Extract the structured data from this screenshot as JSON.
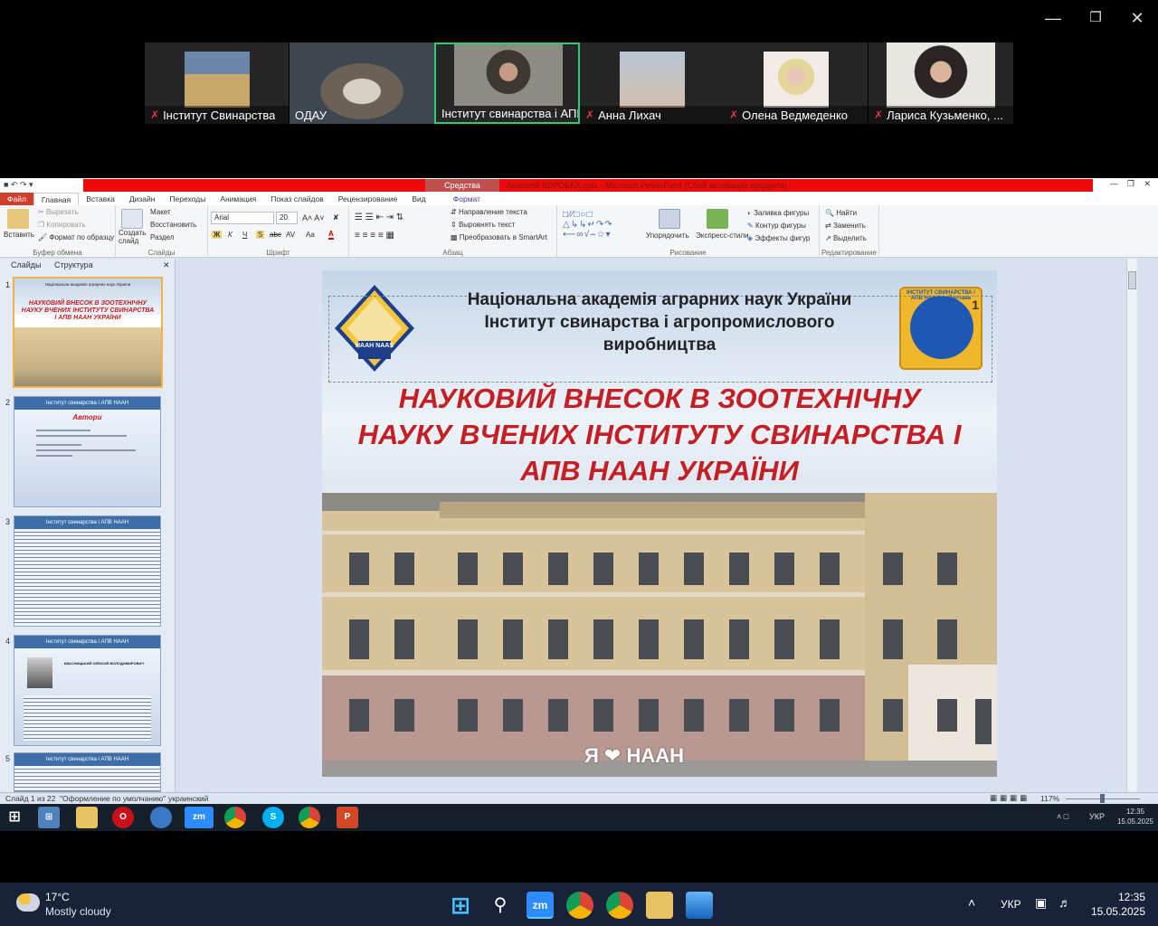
{
  "meeting": {
    "participants": [
      {
        "name": "Інститут Свинарства",
        "muted": true
      },
      {
        "name": "ОДАУ",
        "muted": false
      },
      {
        "name": "Інститут свинарства і АПВ",
        "muted": false,
        "active": true
      },
      {
        "name": "Анна Лихач",
        "muted": true
      },
      {
        "name": "Олена Ведмеденко",
        "muted": true
      },
      {
        "name": "Лариса Кузьменко, ...",
        "muted": true
      }
    ]
  },
  "ppt": {
    "context_tool": "Средства рисования",
    "document_title": "Анатолій КОРОБКА.pptx - Microsoft PowerPoint (Сбой активации продукта)",
    "tabs": [
      "Файл",
      "Главная",
      "Вставка",
      "Дизайн",
      "Переходы",
      "Анимация",
      "Показ слайдов",
      "Рецензирование",
      "Вид",
      "Формат"
    ],
    "ribbon": {
      "paste": "Вставить",
      "cut": "Вырезать",
      "copy": "Копировать",
      "format_painter": "Формат по образцу",
      "clipboard_group": "Буфер обмена",
      "new_slide": "Создать слайд",
      "layout": "Макет",
      "reset": "Восстановить",
      "section": "Раздел",
      "slides_group": "Слайды",
      "font_name": "Arial",
      "font_size": "20",
      "font_group": "Шрифт",
      "bold": "Ж",
      "italic": "К",
      "underline": "Ч",
      "shadow": "S",
      "strike": "abc",
      "spacing": "AV",
      "case": "Aa",
      "color_a": "A",
      "text_direction": "Направление текста",
      "align_text": "Выровнять текст",
      "smartart": "Преобразовать в SmartArt",
      "paragraph_group": "Абзац",
      "arrange": "Упорядочить",
      "quick_styles": "Экспресс-стили",
      "drawing_group": "Рисование",
      "shape_fill": "Заливка фигуры",
      "shape_outline": "Контур фигуры",
      "shape_effects": "Эффекты фигур",
      "find": "Найти",
      "replace": "Заменить",
      "select": "Выделить",
      "editing_group": "Редактирование"
    },
    "panel_tabs": [
      "Слайды",
      "Структура"
    ],
    "thumbnails": [
      {
        "num": "1",
        "head": "Національна академія аграрних наук України",
        "title": "НАУКОВИЙ ВНЕСОК В ЗООТЕХНІЧНУ НАУКУ ВЧЕНИХ ІНСТИТУТУ СВИНАРСТВА І АПВ НААН УКРАЇНИ"
      },
      {
        "num": "2",
        "head": "Інститут свинарства і АПВ НААН",
        "title": "Автори"
      },
      {
        "num": "3",
        "head": "Інститут свинарства і АПВ НААН"
      },
      {
        "num": "4",
        "head": "Інститут свинарства і АПВ НААН",
        "title": "КВАСНИЦЬКИЙ ОЛЕКСІЙ ВОЛОДИМИРОВИЧ"
      },
      {
        "num": "5",
        "head": "Інститут свинарства і АПВ НААН"
      }
    ],
    "slide": {
      "header_line1": "Національна академія аграрних наук України",
      "header_line2": "Інститут свинарства і агропромислового",
      "header_line3": "виробництва",
      "logo_left": "НААН NAAS",
      "logo_right": "ІНСТИТУТ СВИНАРСТВА і АПВ НААН, м.Полтава",
      "logo_num": "1",
      "title_line1": "НАУКОВИЙ ВНЕСОК В ЗООТЕХНІЧНУ",
      "title_line2": "НАУКУ ВЧЕНИХ ІНСТИТУТУ СВИНАРСТВА І",
      "title_line3": "АПВ НААН УКРАЇНИ",
      "sign": "Я ❤ НААН"
    },
    "status": {
      "slide_info": "Слайд 1 из 22",
      "theme": "\"Оформление по умолчанию\"",
      "language": "украинский",
      "zoom": "117%"
    }
  },
  "inner_taskbar": {
    "lang": "УКР",
    "time": "12:35",
    "date": "15.05.2025"
  },
  "outer_taskbar": {
    "weather_temp": "17°C",
    "weather_desc": "Mostly cloudy",
    "lang": "УКР",
    "time": "12:35",
    "date": "15.05.2025"
  }
}
